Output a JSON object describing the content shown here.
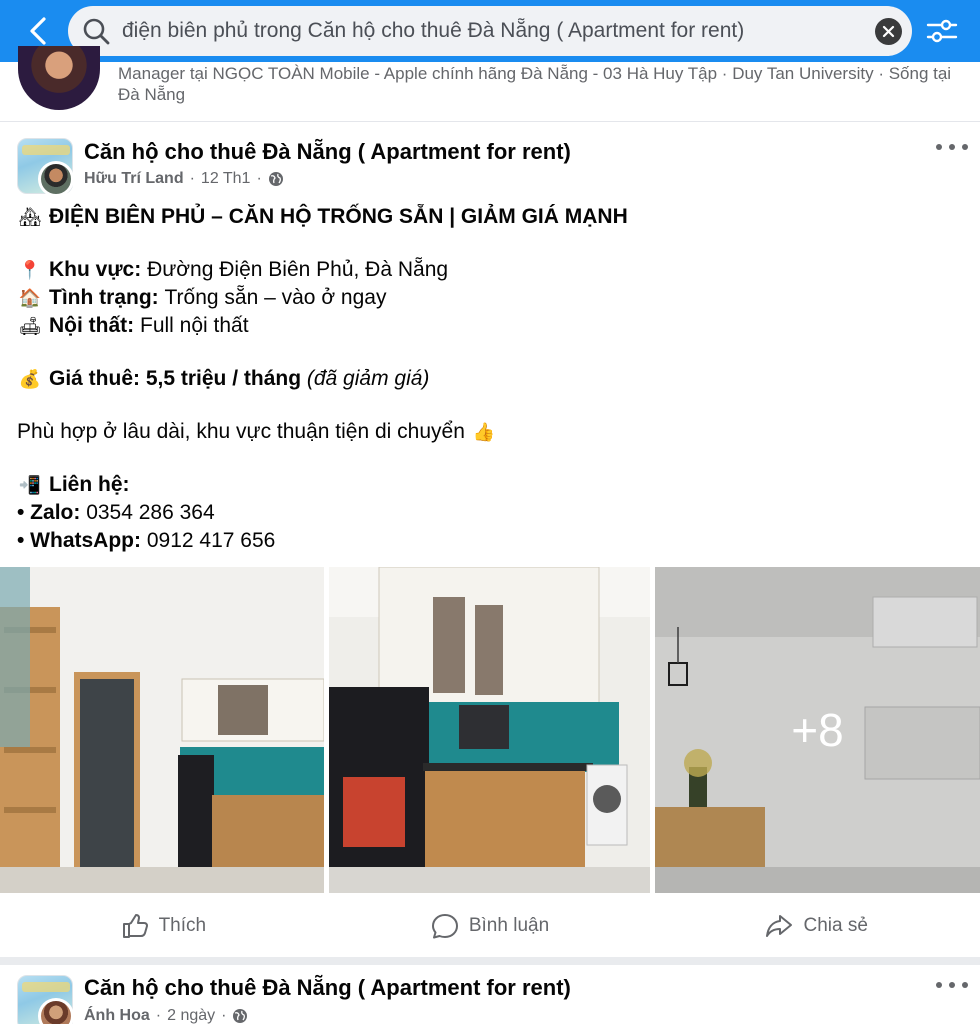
{
  "search": {
    "query": "điện biên phủ trong Căn hộ cho thuê Đà Nẵng ( Apartment for rent)"
  },
  "previous_result": {
    "subtitle": "Manager tại NGỌC TOÀN Mobile - Apple chính hãng Đà Nẵng - 03 Hà Huy Tập · Duy Tan University · Sống tại Đà Nẵng"
  },
  "post": {
    "group_name": "Căn hộ cho thuê Đà Nẵng ( Apartment for rent)",
    "author": "Hữu Trí Land",
    "separator": "·",
    "date": "12 Th1",
    "headline": "ĐIỆN BIÊN PHỦ – CĂN HỘ TRỐNG SẴN | GIẢM GIÁ MẠNH",
    "area_label": "Khu vực:",
    "area_value": "Đường Điện Biên Phủ, Đà Nẵng",
    "status_label": "Tình trạng:",
    "status_value": "Trống sẵn – vào ở ngay",
    "furniture_label": "Nội thất:",
    "furniture_value": "Full nội thất",
    "price_label": "Giá thuê: 5,5 triệu / tháng",
    "price_note": "(đã giảm giá)",
    "suitability": "Phù hợp ở lâu dài, khu vực thuận tiện di chuyển",
    "contact_label": "Liên hệ:",
    "zalo_label": "• Zalo:",
    "zalo_value": "0354 286 364",
    "whatsapp_label": "• WhatsApp:",
    "whatsapp_value": "0912 417 656",
    "more_photos": "+8",
    "emoji": {
      "tree": "🏘",
      "pin": "📍",
      "house": "🏠",
      "sofa": "🛋",
      "moneybag": "💰",
      "thumb": "👍",
      "phone": "📲"
    }
  },
  "actions": {
    "like": "Thích",
    "comment": "Bình luận",
    "share": "Chia sẻ"
  },
  "post2": {
    "group_name": "Căn hộ cho thuê Đà Nẵng ( Apartment for rent)",
    "author": "Ánh Hoa",
    "separator": "·",
    "date": "2 ngày"
  },
  "colors": {
    "topbar": "#1a8cf0",
    "secondary_text": "#65676b",
    "primary_text": "#050505"
  }
}
